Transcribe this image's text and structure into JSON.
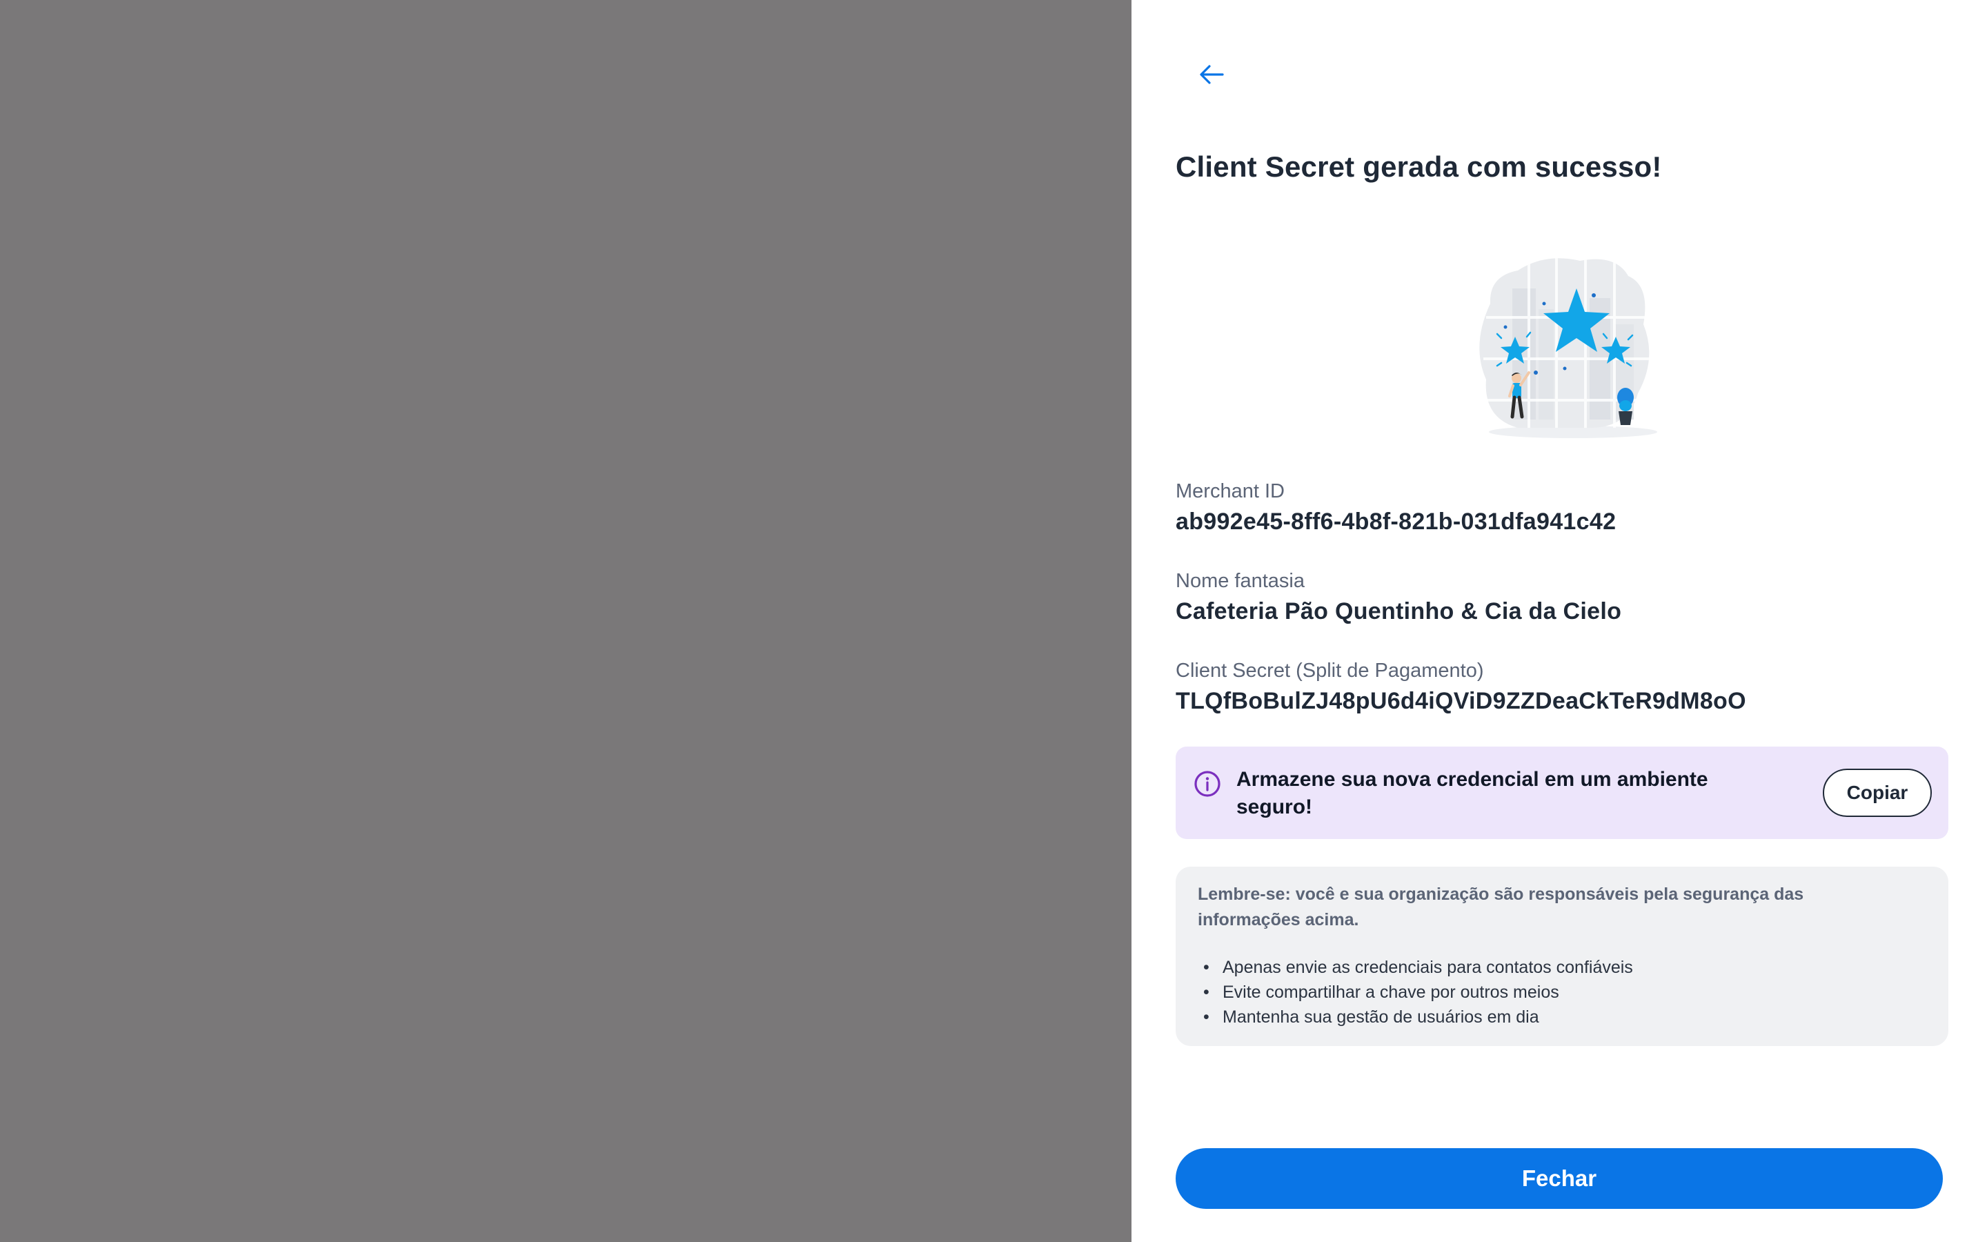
{
  "panel": {
    "title": "Client Secret gerada com sucesso!",
    "back_icon": "arrow-left-icon"
  },
  "fields": {
    "merchant_id": {
      "label": "Merchant ID",
      "value": "ab992e45-8ff6-4b8f-821b-031dfa941c42"
    },
    "trade_name": {
      "label": "Nome fantasia",
      "value": "Cafeteria Pão Quentinho & Cia da Cielo"
    },
    "client_secret": {
      "label": "Client Secret (Split de Pagamento)",
      "value": "TLQfBoBulZJ48pU6d4iQViD9ZZDeaCkTeR9dM8oO"
    }
  },
  "notice": {
    "icon": "info-icon",
    "text": "Armazene sua nova credencial em um ambiente seguro!",
    "copy_label": "Copiar"
  },
  "reminder": {
    "heading": "Lembre-se: você e sua organização são responsáveis pela segurança das informações acima.",
    "items": [
      "Apenas envie as credenciais para contatos confiáveis",
      "Evite compartilhar a chave por outros meios",
      "Mantenha sua gestão de usuários em dia"
    ]
  },
  "footer": {
    "close_label": "Fechar"
  },
  "colors": {
    "overlay": "#7a7879",
    "primary": "#0a75e6",
    "notice_bg": "#ede5fb",
    "notice_icon": "#7b2fbe",
    "reminder_bg": "#f0f1f3",
    "illustration_accent": "#12a6e8"
  }
}
